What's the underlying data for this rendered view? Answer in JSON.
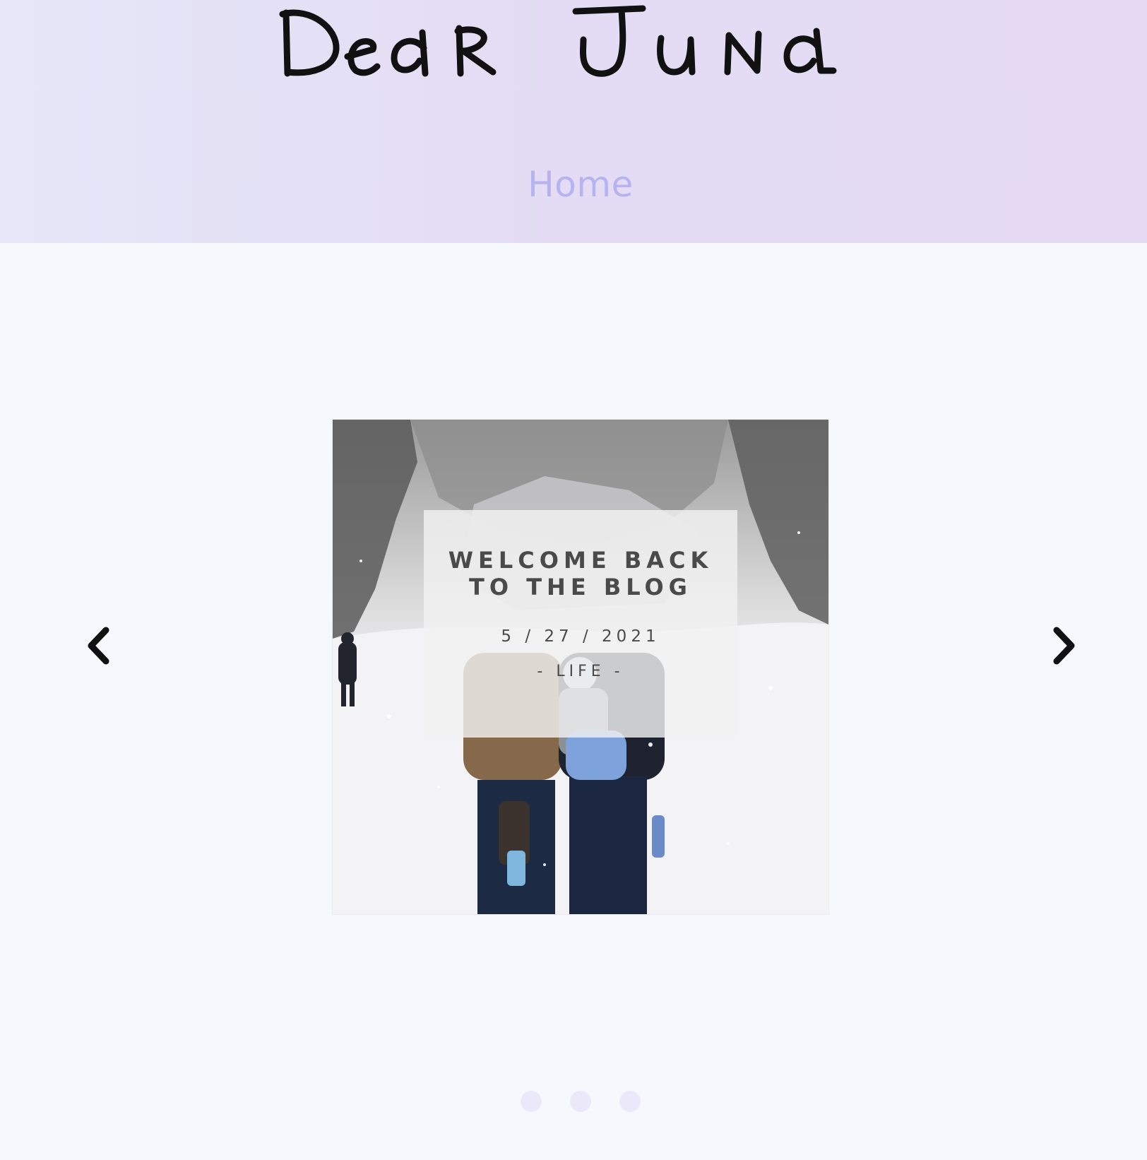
{
  "site": {
    "logo_text": "Dear Juna",
    "nav": [
      {
        "label": "Home"
      }
    ]
  },
  "slider": {
    "current_slide": 1,
    "slides": [
      {
        "title": "WELCOME BACK TO THE BLOG",
        "date": "5 / 27 / 2021",
        "category": "- LIFE -"
      }
    ],
    "pagination": {
      "count": 3,
      "active": 1
    },
    "prev_icon": "chevron-left-icon",
    "next_icon": "chevron-right-icon"
  },
  "colors": {
    "header_gradient_start": "#e6e6f8",
    "header_gradient_end": "#e6d9f4",
    "nav_link": "#b6b3f0",
    "page_background": "#f7f8fd",
    "caption_text": "#4a4a4a",
    "dot": "#ebe8fa"
  }
}
